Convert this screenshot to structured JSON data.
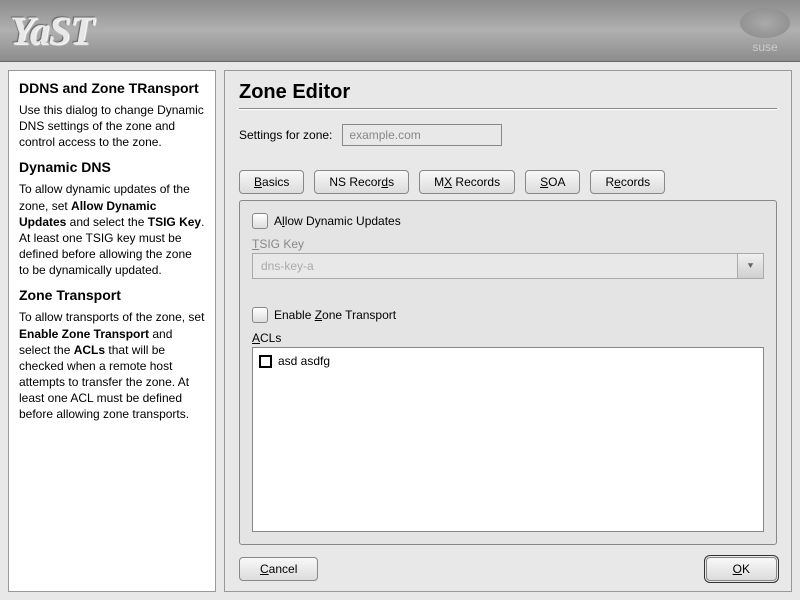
{
  "header": {
    "logo": "YaST",
    "brand": "suse"
  },
  "sidebar": {
    "sections": [
      {
        "heading": "DDNS and Zone TRansport",
        "body_html": "Use this dialog to change Dynamic DNS settings of the zone and control access to the zone."
      },
      {
        "heading": "Dynamic DNS",
        "body_html": "To allow dynamic updates of the zone, set <b>Allow Dynamic Updates</b> and select the <b>TSIG Key</b>. At least one TSIG key must be defined before allowing the zone to be dynamically updated."
      },
      {
        "heading": "Zone Transport",
        "body_html": "To allow transports of the zone, set <b>Enable Zone Transport</b> and select the <b>ACLs</b> that will be checked when a remote host attempts to transfer the zone. At least one ACL must be defined before allowing zone transports."
      }
    ]
  },
  "main": {
    "title": "Zone Editor",
    "settings_label": "Settings for zone:",
    "zone_value": "example.com",
    "tabs": {
      "basics": "Basics",
      "ns": "NS Records",
      "mx": "MX Records",
      "soa": "SOA",
      "records": "Records"
    },
    "allow_dynamic": {
      "label": "Allow Dynamic Updates",
      "checked": false
    },
    "tsig": {
      "label": "TSIG Key",
      "value": "dns-key-a"
    },
    "enable_transport": {
      "label": "Enable Zone Transport",
      "checked": false
    },
    "acls": {
      "label": "ACLs",
      "items": [
        {
          "checked": false,
          "text": "asd asdfg"
        }
      ]
    },
    "buttons": {
      "cancel": "Cancel",
      "ok": "OK"
    }
  }
}
